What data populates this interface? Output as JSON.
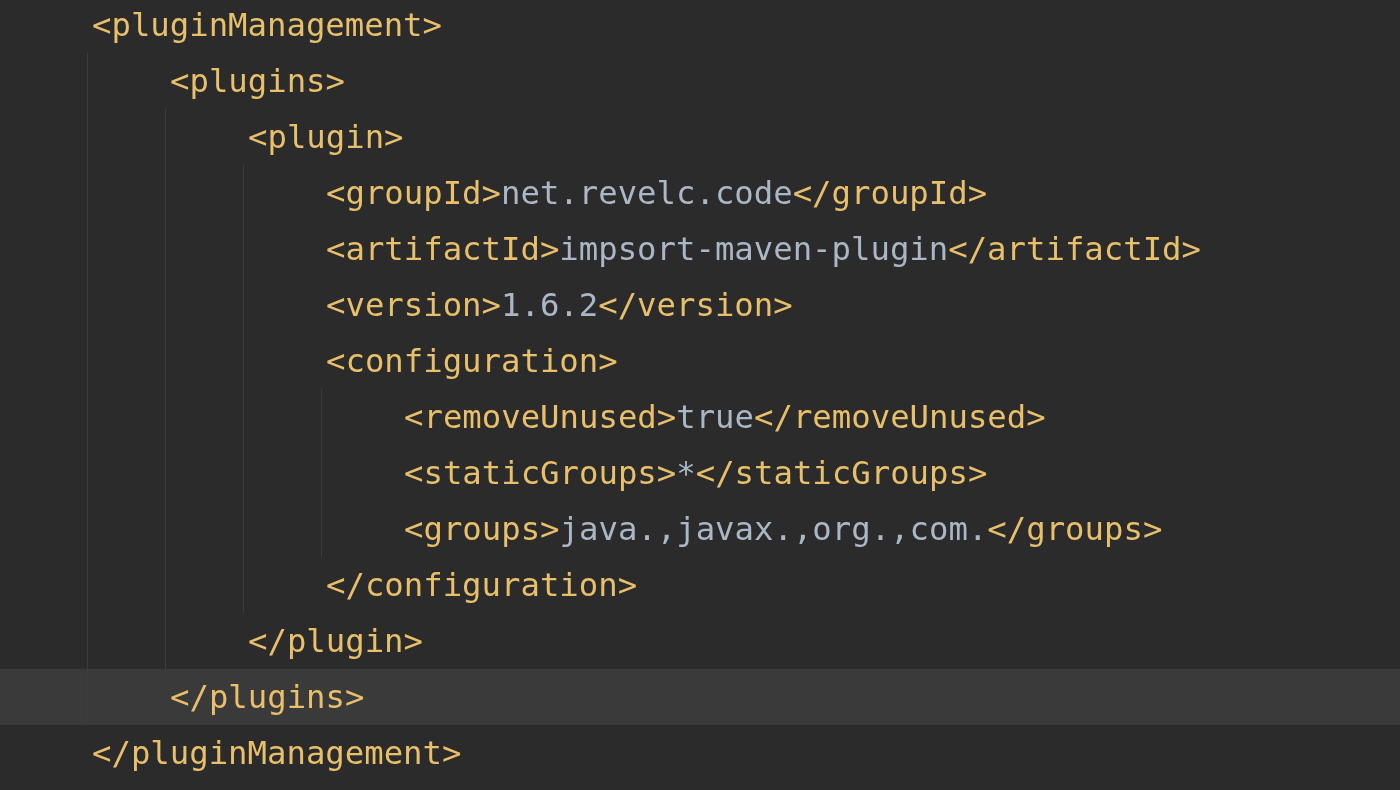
{
  "editor": {
    "root": {
      "open": "<pluginManagement>",
      "close": "</pluginManagement>",
      "open_current": false,
      "close_current": false,
      "children": [
        {
          "open": "<plugins>",
          "close": "</plugins>",
          "open_current": false,
          "close_current": true,
          "children": [
            {
              "open": "<plugin>",
              "close": "</plugin>",
              "open_current": false,
              "close_current": false,
              "children": [
                {
                  "open": "<groupId>",
                  "text": "net.revelc.code",
                  "close": "</groupId>",
                  "current": false
                },
                {
                  "open": "<artifactId>",
                  "text": "impsort-maven-plugin",
                  "close": "</artifactId>",
                  "current": false
                },
                {
                  "open": "<version>",
                  "text": "1.6.2",
                  "close": "</version>",
                  "current": false
                },
                {
                  "open": "<configuration>",
                  "close": "</configuration>",
                  "open_current": false,
                  "close_current": false,
                  "children": [
                    {
                      "open": "<removeUnused>",
                      "text": "true",
                      "close": "</removeUnused>",
                      "current": false
                    },
                    {
                      "open": "<staticGroups>",
                      "text": "*",
                      "close": "</staticGroups>",
                      "current": false
                    },
                    {
                      "open": "<groups>",
                      "text": "java.,javax.,org.,com.",
                      "close": "</groups>",
                      "current": false
                    }
                  ]
                }
              ]
            }
          ]
        }
      ]
    }
  }
}
